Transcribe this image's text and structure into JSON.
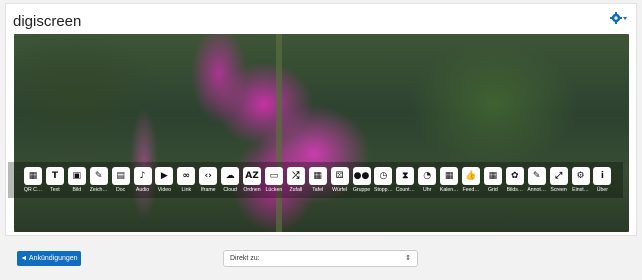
{
  "header": {
    "title": "digiscreen",
    "settings_icon": "gear-icon"
  },
  "toolbar": {
    "tools": [
      {
        "label": "QR C…",
        "icon": "qr-icon",
        "glyph": "▦"
      },
      {
        "label": "Text",
        "icon": "text-icon",
        "glyph": "T"
      },
      {
        "label": "Bild",
        "icon": "image-icon",
        "glyph": "▣"
      },
      {
        "label": "Zeich…",
        "icon": "draw-icon",
        "glyph": "✎"
      },
      {
        "label": "Doc",
        "icon": "document-icon",
        "glyph": "▤"
      },
      {
        "label": "Audio",
        "icon": "audio-icon",
        "glyph": "♪"
      },
      {
        "label": "Video",
        "icon": "video-icon",
        "glyph": "▶"
      },
      {
        "label": "Link",
        "icon": "link-icon",
        "glyph": "∞"
      },
      {
        "label": "Iframe",
        "icon": "iframe-icon",
        "glyph": "‹›"
      },
      {
        "label": "Cloud",
        "icon": "cloud-icon",
        "glyph": "☁"
      },
      {
        "label": "Ordnen",
        "icon": "sort-icon",
        "glyph": "AZ"
      },
      {
        "label": "Lücken",
        "icon": "gaps-icon",
        "glyph": "▭"
      },
      {
        "label": "Zufall",
        "icon": "shuffle-icon",
        "glyph": "⤮"
      },
      {
        "label": "Tafel",
        "icon": "board-icon",
        "glyph": "▦"
      },
      {
        "label": "Würfel",
        "icon": "dice-icon",
        "glyph": "⚄"
      },
      {
        "label": "Gruppe",
        "icon": "group-icon",
        "glyph": "●●"
      },
      {
        "label": "Stopp…",
        "icon": "stopwatch-icon",
        "glyph": "◷"
      },
      {
        "label": "Count…",
        "icon": "countdown-icon",
        "glyph": "⧗"
      },
      {
        "label": "Uhr",
        "icon": "clock-icon",
        "glyph": "◔"
      },
      {
        "label": "Kalen…",
        "icon": "calendar-icon",
        "glyph": "▦"
      },
      {
        "label": "Feed…",
        "icon": "feedback-icon",
        "glyph": "👍"
      },
      {
        "label": "Grid",
        "icon": "grid-icon",
        "glyph": "▦"
      },
      {
        "label": "Bilds…",
        "icon": "background-icon",
        "glyph": "✿"
      },
      {
        "label": "Annot…",
        "icon": "annotation-icon",
        "glyph": "✎"
      },
      {
        "label": "Screen",
        "icon": "fullscreen-icon",
        "glyph": "⤢"
      },
      {
        "label": "Einst…",
        "icon": "settings-icon",
        "glyph": "⚙"
      },
      {
        "label": "Über",
        "icon": "info-icon",
        "glyph": "i"
      }
    ]
  },
  "footer": {
    "announcements_button": "◄ Ankündigungen",
    "jump_select": {
      "value": "Direkt zu:"
    }
  },
  "colors": {
    "accent": "#0f6cbf",
    "page_bg": "#f2f2f2"
  }
}
